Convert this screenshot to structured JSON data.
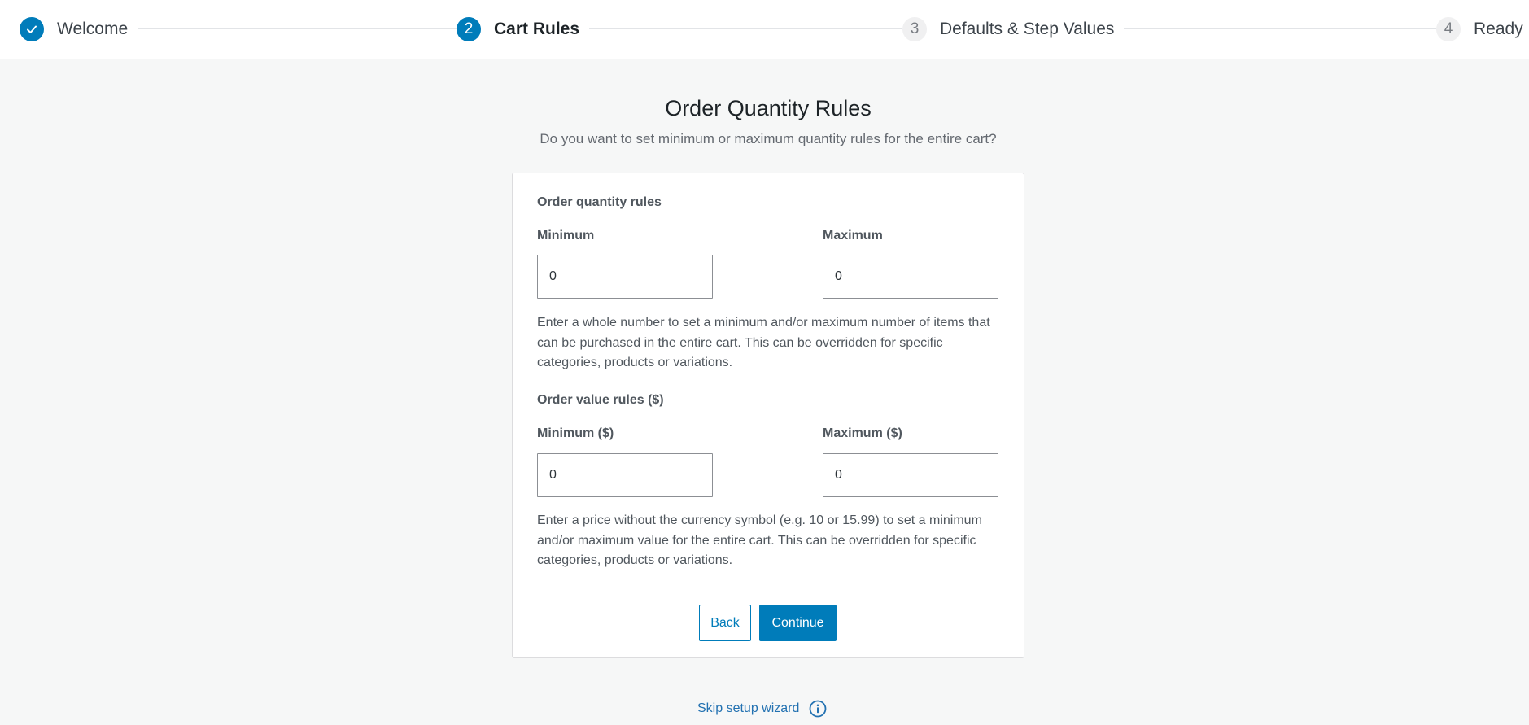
{
  "stepper": {
    "steps": [
      {
        "number": "",
        "label": "Welcome",
        "state": "done"
      },
      {
        "number": "2",
        "label": "Cart Rules",
        "state": "active"
      },
      {
        "number": "3",
        "label": "Defaults & Step Values",
        "state": "pending"
      },
      {
        "number": "4",
        "label": "Ready",
        "state": "pending"
      }
    ]
  },
  "main": {
    "title": "Order Quantity Rules",
    "subtitle": "Do you want to set minimum or maximum quantity rules for the entire cart?"
  },
  "quantity_rules": {
    "title": "Order quantity rules",
    "min_label": "Minimum",
    "min_value": "0",
    "max_label": "Maximum",
    "max_value": "0",
    "help": "Enter a whole number to set a minimum and/or maximum number of items that can be purchased in the entire cart. This can be overridden for specific categories, products or variations."
  },
  "value_rules": {
    "title": "Order value rules ($)",
    "min_label": "Minimum ($)",
    "min_value": "0",
    "max_label": "Maximum ($)",
    "max_value": "0",
    "help": "Enter a price without the currency symbol (e.g. 10 or 15.99) to set a minimum and/or maximum value for the entire cart. This can be overridden for specific categories, products or variations."
  },
  "footer": {
    "back_label": "Back",
    "continue_label": "Continue"
  },
  "skip": {
    "label": "Skip setup wizard"
  },
  "colors": {
    "accent": "#007cba",
    "link": "#2271b1",
    "background": "#f6f7f7"
  }
}
